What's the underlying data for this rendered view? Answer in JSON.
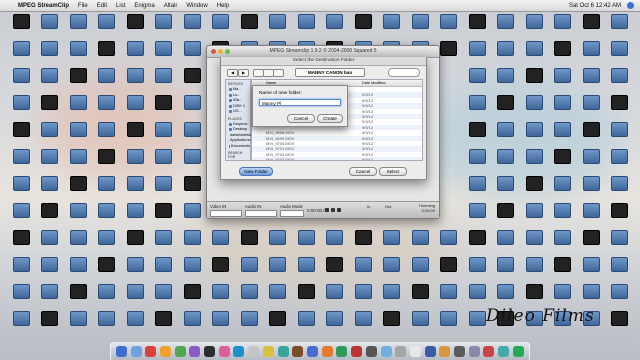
{
  "menubar": {
    "app_name": "MPEG StreamClip",
    "items": [
      "File",
      "Edit",
      "List",
      "Enigma",
      "Altair",
      "Window",
      "Help"
    ],
    "clock": "Sat Oct 6 12:42 AM"
  },
  "main_window": {
    "title": "MPEG Streamclip 1.9.2 © 2004-2008 Squared 5",
    "video_label": "Video IN",
    "audio_label": "Audio IN",
    "audio_mode_label": "Audio Mode",
    "time": "0:00:00.00",
    "in_label": "In",
    "out_label": "Out",
    "timing_label": "Trimming",
    "timing_value": "0:00:00"
  },
  "sheet": {
    "title": "Select the Destination Folder",
    "location": "MANNY CANON ban",
    "sidebar": {
      "devices_header": "DEVICES",
      "devices": [
        "Ma...",
        "Lo...",
        "iDis...",
        "DISK 1",
        "OS..."
      ],
      "places_header": "PLACES",
      "places": [
        "Dropbox",
        "Desktop",
        "danielsnfeider",
        "Applications",
        "Documents"
      ],
      "search_header": "SEARCH FOR"
    },
    "columns": {
      "name": "Name",
      "date": "Date Modified"
    },
    "section": "New Folder",
    "files": [
      {
        "name": "",
        "date": "9/9/12"
      },
      {
        "name": "",
        "date": "9/9/12"
      },
      {
        "name": "",
        "date": "9/9/12"
      },
      {
        "name": "",
        "date": "9/9/12"
      },
      {
        "name": "",
        "date": "9/9/12"
      },
      {
        "name": "",
        "date": "9/9/12"
      },
      {
        "name": "",
        "date": "9/9/12"
      },
      {
        "name": "MVI_9698.MOV",
        "date": "9/9/12"
      },
      {
        "name": "MVI_9699.MOV",
        "date": "9/9/12"
      },
      {
        "name": "MVI_9700.MOV",
        "date": "9/9/12"
      },
      {
        "name": "MVI_9701.MOV",
        "date": "9/9/12"
      },
      {
        "name": "MVI_9702.MOV",
        "date": "9/9/12"
      },
      {
        "name": "MVI_9703.MOV",
        "date": "9/9/12"
      }
    ],
    "new_folder_button": "New Folder",
    "cancel_button": "Cancel",
    "select_button": "Select"
  },
  "new_folder_dialog": {
    "label": "Name of new folder:",
    "value": "Manny Pl",
    "cancel_button": "Cancel",
    "create_button": "Create"
  },
  "watermark": "Dileo Films",
  "accent_color": "#5d8fd9"
}
